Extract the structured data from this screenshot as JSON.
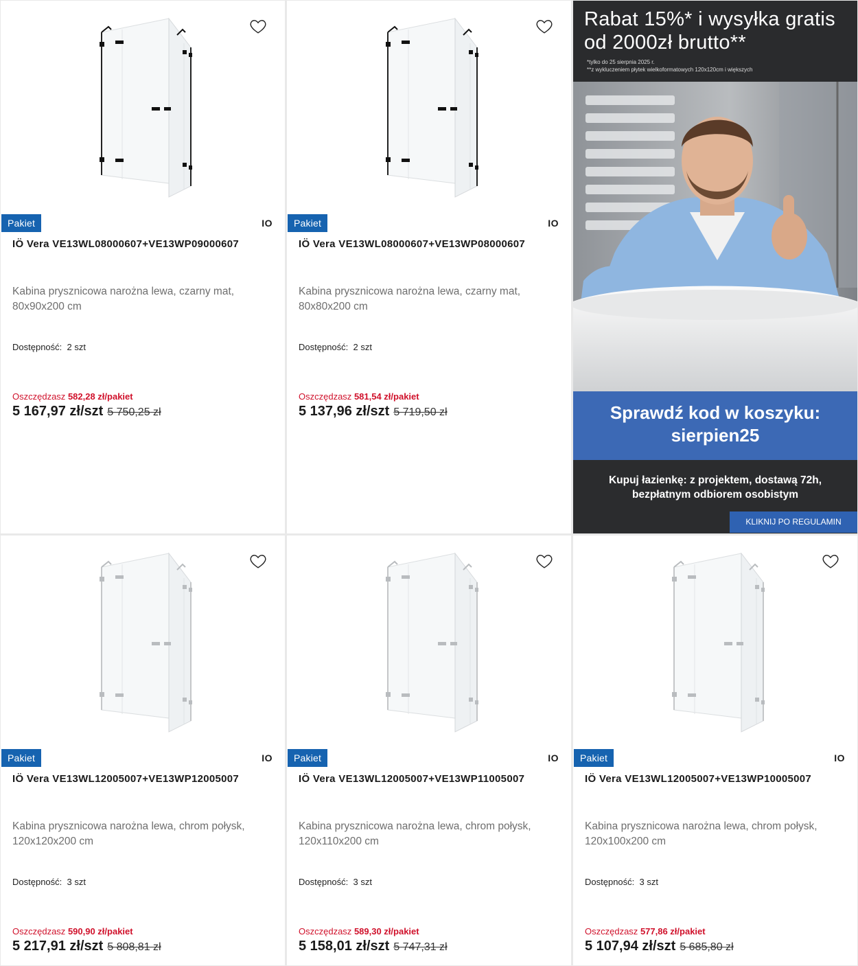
{
  "products": [
    {
      "badge": "Pakiet",
      "brand": "IO",
      "title": "IÖ Vera VE13WL08000607+VE13WP09000607",
      "description": "Kabina prysznicowa narożna lewa, czarny mat, 80x90x200 cm",
      "stock_label": "Dostępność:",
      "stock_value": "2 szt",
      "save_label": "Oszczędzasz",
      "save_value": "582,28 zł/pakiet",
      "price": "5 167,97 zł/szt",
      "old_price": "5 750,25 zł",
      "fittings": "black"
    },
    {
      "badge": "Pakiet",
      "brand": "IO",
      "title": "IÖ Vera VE13WL08000607+VE13WP08000607",
      "description": "Kabina prysznicowa narożna lewa, czarny mat, 80x80x200 cm",
      "stock_label": "Dostępność:",
      "stock_value": "2 szt",
      "save_label": "Oszczędzasz",
      "save_value": "581,54 zł/pakiet",
      "price": "5 137,96 zł/szt",
      "old_price": "5 719,50 zł",
      "fittings": "black"
    },
    {
      "badge": "Pakiet",
      "brand": "IO",
      "title": "IÖ Vera VE13WL12005007+VE13WP12005007",
      "description": "Kabina prysznicowa narożna lewa, chrom połysk, 120x120x200 cm",
      "stock_label": "Dostępność:",
      "stock_value": "3 szt",
      "save_label": "Oszczędzasz",
      "save_value": "590,90 zł/pakiet",
      "price": "5 217,91 zł/szt",
      "old_price": "5 808,81 zł",
      "fittings": "chrome"
    },
    {
      "badge": "Pakiet",
      "brand": "IO",
      "title": "IÖ Vera VE13WL12005007+VE13WP11005007",
      "description": "Kabina prysznicowa narożna lewa, chrom połysk, 120x110x200 cm",
      "stock_label": "Dostępność:",
      "stock_value": "3 szt",
      "save_label": "Oszczędzasz",
      "save_value": "589,30 zł/pakiet",
      "price": "5 158,01 zł/szt",
      "old_price": "5 747,31 zł",
      "fittings": "chrome"
    },
    {
      "badge": "Pakiet",
      "brand": "IO",
      "title": "IÖ Vera VE13WL12005007+VE13WP10005007",
      "description": "Kabina prysznicowa narożna lewa, chrom połysk, 120x100x200 cm",
      "stock_label": "Dostępność:",
      "stock_value": "3 szt",
      "save_label": "Oszczędzasz",
      "save_value": "577,86 zł/pakiet",
      "price": "5 107,94 zł/szt",
      "old_price": "5 685,80 zł",
      "fittings": "chrome"
    }
  ],
  "banner": {
    "headline": "Rabat 15%* i wysyłka gratis od 2000zł brutto**",
    "note1": "*tylko do 25 sierpnia 2025 r.",
    "note2": "**z wykluczeniem płytek wielkoformatowych 120x120cm i większych",
    "code_line1": "Sprawdź kod w koszyku:",
    "code_line2": "sierpien25",
    "subline": "Kupuj łazienkę: z projektem, dostawą 72h, bezpłatnym odbiorem osobistym",
    "button": "KLIKNIJ PO REGULAMIN"
  },
  "colors": {
    "badge": "#1663b0",
    "save": "#d0112b",
    "code_band": "#3c69b5",
    "banner_dark": "#2b2c2e"
  },
  "icons": {
    "favorite": "heart-outline-icon"
  }
}
